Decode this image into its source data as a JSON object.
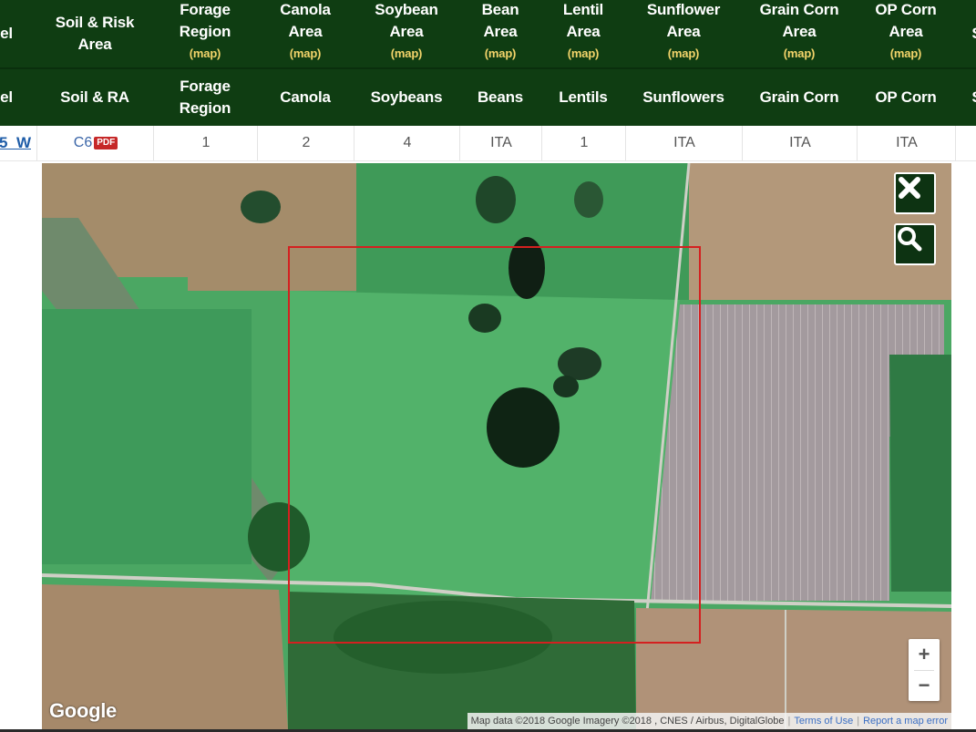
{
  "header": {
    "row1": [
      {
        "label": "el"
      },
      {
        "label": "Soil & Risk\nArea"
      },
      {
        "label": "Forage\nRegion",
        "map": "(map)"
      },
      {
        "label": "Canola\nArea",
        "map": "(map)"
      },
      {
        "label": "Soybean\nArea",
        "map": "(map)"
      },
      {
        "label": "Bean\nArea",
        "map": "(map)"
      },
      {
        "label": "Lentil\nArea",
        "map": "(map)"
      },
      {
        "label": "Sunflower\nArea",
        "map": "(map)"
      },
      {
        "label": "Grain Corn\nArea",
        "map": "(map)"
      },
      {
        "label": "OP Corn\nArea",
        "map": "(map)"
      },
      {
        "label": "S"
      }
    ],
    "row2": [
      "el",
      "Soil & RA",
      "Forage\nRegion",
      "Canola",
      "Soybeans",
      "Beans",
      "Lentils",
      "Sunflowers",
      "Grain Corn",
      "OP Corn",
      "S"
    ]
  },
  "data_row": {
    "legal": "5  W",
    "soil": "C6",
    "pdf_badge": "PDF",
    "forage": "1",
    "canola": "2",
    "soybean": "4",
    "bean": "ITA",
    "lentil": "1",
    "sunflower": "ITA",
    "grain_corn": "ITA",
    "op_corn": "ITA"
  },
  "map": {
    "logo": "Google",
    "attribution": "Map data ©2018 Google Imagery ©2018 , CNES / Airbus, DigitalGlobe",
    "terms": "Terms of Use",
    "report": "Report a map error",
    "zoom_in": "+",
    "zoom_out": "−",
    "close_icon": "close-icon",
    "search_icon": "search-icon",
    "selection_color": "#d42020"
  },
  "colors": {
    "header_bg": "#0f3d12",
    "map_link": "#f3d46a",
    "link_blue": "#1f5da8"
  }
}
